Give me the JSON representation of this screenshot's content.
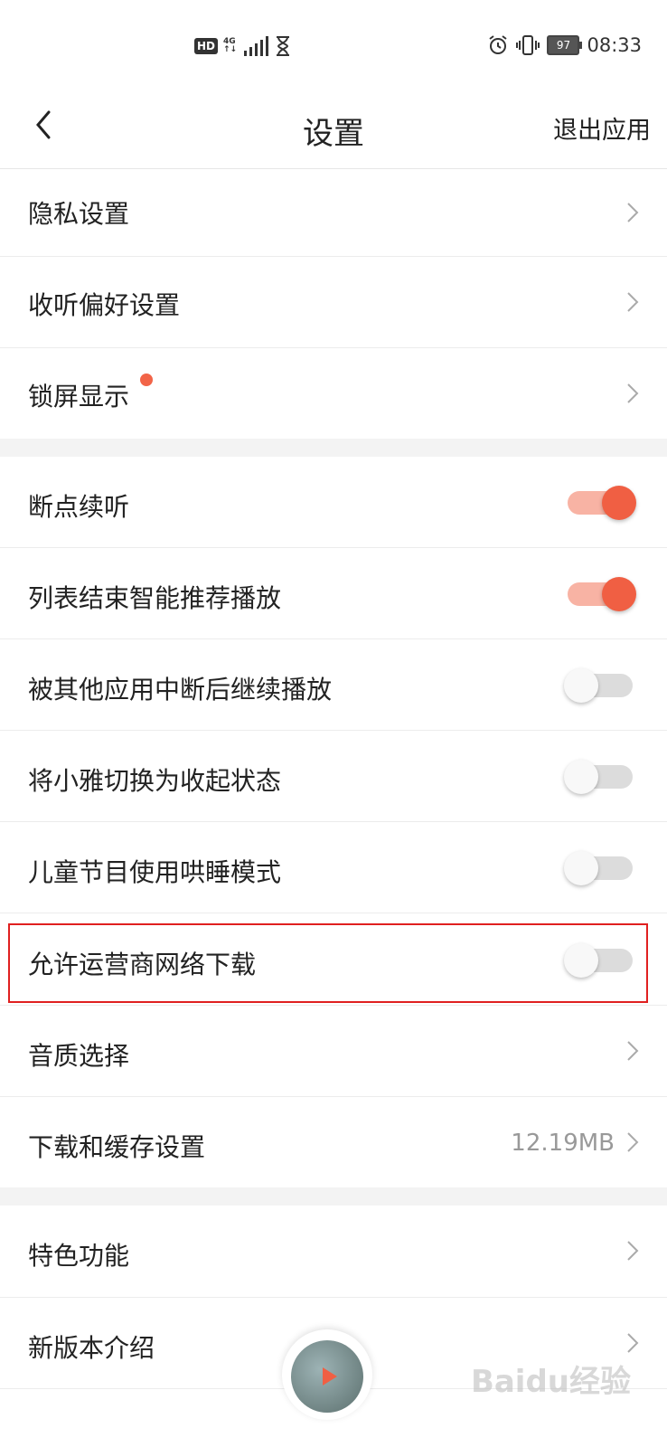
{
  "status_bar": {
    "hd": "HD",
    "network": "4G",
    "battery": "97",
    "time": "08:33"
  },
  "header": {
    "title": "设置",
    "exit_label": "退出应用"
  },
  "sections": [
    {
      "rows": [
        {
          "label": "隐私设置",
          "control": "chevron"
        },
        {
          "label": "收听偏好设置",
          "control": "chevron"
        },
        {
          "label": "锁屏显示",
          "control": "chevron",
          "badge": "red-dot"
        }
      ]
    },
    {
      "rows": [
        {
          "label": "断点续听",
          "control": "toggle",
          "on": true
        },
        {
          "label": "列表结束智能推荐播放",
          "control": "toggle",
          "on": true
        },
        {
          "label": "被其他应用中断后继续播放",
          "control": "toggle",
          "on": false
        },
        {
          "label": "将小雅切换为收起状态",
          "control": "toggle",
          "on": false
        },
        {
          "label": "儿童节目使用哄睡模式",
          "control": "toggle",
          "on": false
        },
        {
          "label": "允许运营商网络下载",
          "control": "toggle",
          "on": false
        },
        {
          "label": "音质选择",
          "control": "chevron"
        },
        {
          "label": "下载和缓存设置",
          "control": "chevron",
          "value": "12.19MB"
        }
      ]
    },
    {
      "rows": [
        {
          "label": "特色功能",
          "control": "chevron"
        },
        {
          "label": "新版本介绍",
          "control": "chevron"
        }
      ]
    }
  ],
  "watermark": "Baidu经验",
  "colors": {
    "accent": "#f05f43",
    "toggle_track_on": "#f8b3a4",
    "highlight_border": "#e02020"
  }
}
